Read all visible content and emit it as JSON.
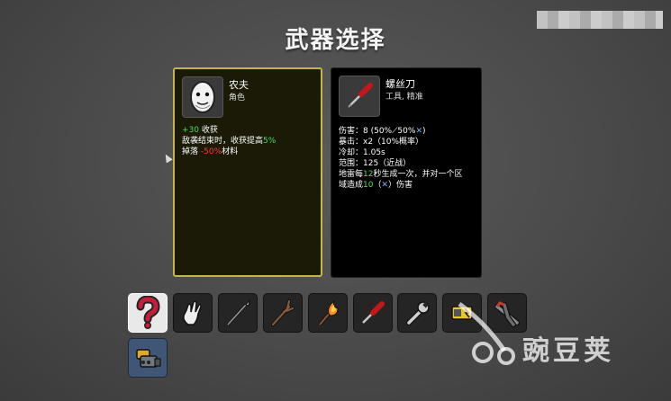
{
  "screen": {
    "title": "武器选择"
  },
  "character": {
    "name": "农夫",
    "role": "角色",
    "stat_lines": [
      {
        "parts": [
          {
            "text": "+30",
            "color": "green"
          },
          {
            "text": " 收获",
            "color": "white"
          }
        ]
      },
      {
        "parts": [
          {
            "text": "敌袭结束时，收获提高",
            "color": "white"
          },
          {
            "text": "5%",
            "color": "green"
          }
        ]
      },
      {
        "parts": [
          {
            "text": "掉落 ",
            "color": "white"
          },
          {
            "text": "-50%",
            "color": "red"
          },
          {
            "text": "材料",
            "color": "white"
          }
        ]
      }
    ]
  },
  "weapon": {
    "name": "螺丝刀",
    "tags": "工具, 精准",
    "stat_lines": [
      {
        "parts": [
          {
            "text": "伤害：8 (50%",
            "color": "white"
          },
          {
            "text": "⟋",
            "color": "white"
          },
          {
            "text": "50%",
            "color": "white"
          },
          {
            "text": "✕",
            "color": "blue"
          },
          {
            "text": ")",
            "color": "white"
          }
        ]
      },
      {
        "parts": [
          {
            "text": "暴击：x2（10%概率）",
            "color": "white"
          }
        ]
      },
      {
        "parts": [
          {
            "text": "冷却：1.05s",
            "color": "white"
          }
        ]
      },
      {
        "parts": [
          {
            "text": "范围：125（近战）",
            "color": "white"
          }
        ]
      },
      {
        "parts": [
          {
            "text": "地雷每",
            "color": "white"
          },
          {
            "text": "12",
            "color": "green"
          },
          {
            "text": "秒生成一次，并对一个区",
            "color": "white"
          }
        ]
      },
      {
        "parts": [
          {
            "text": "域造成",
            "color": "white"
          },
          {
            "text": "10",
            "color": "green"
          },
          {
            "text": "（",
            "color": "white"
          },
          {
            "text": "✕",
            "color": "blue"
          },
          {
            "text": "）伤害",
            "color": "white"
          }
        ]
      }
    ]
  },
  "weapon_slots": [
    {
      "name": "random-weapon-slot",
      "icon": "question-mark-icon"
    },
    {
      "name": "hand-weapon-slot",
      "icon": "hand-icon"
    },
    {
      "name": "spear-weapon-slot",
      "icon": "spear-icon"
    },
    {
      "name": "stick-weapon-slot",
      "icon": "stick-icon"
    },
    {
      "name": "torch-weapon-slot",
      "icon": "torch-icon"
    },
    {
      "name": "screwdriver-weapon-slot",
      "icon": "screwdriver-icon"
    },
    {
      "name": "wrench-weapon-slot",
      "icon": "wrench-icon"
    },
    {
      "name": "taser-weapon-slot",
      "icon": "taser-icon"
    },
    {
      "name": "pliers-weapon-slot",
      "icon": "pliers-icon"
    },
    {
      "name": "minigun-weapon-slot",
      "icon": "minigun-icon"
    }
  ],
  "watermark": {
    "text": "豌豆荚"
  },
  "colors": {
    "green": "#4ee04e",
    "red": "#ff3a3a",
    "blue": "#7fb2ff",
    "panel_border": "#c8b54a"
  }
}
